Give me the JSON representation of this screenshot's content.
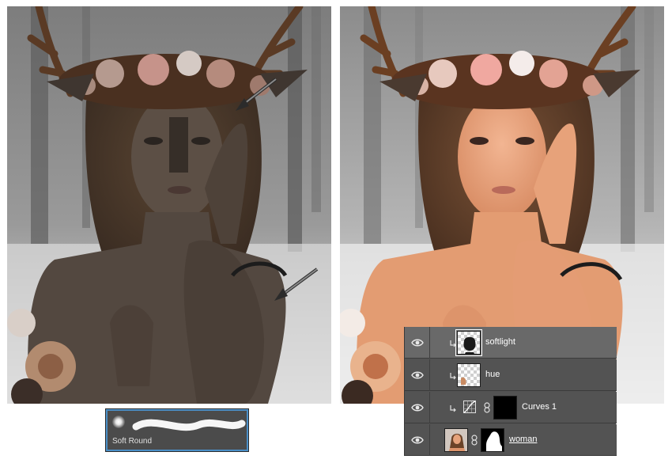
{
  "brush_preset": {
    "label": "Soft Round"
  },
  "layers_panel": {
    "rows": [
      {
        "name": "softlight",
        "selected": true,
        "clipped": true,
        "visible": true
      },
      {
        "name": "hue",
        "selected": false,
        "clipped": true,
        "visible": true
      },
      {
        "name": "Curves 1",
        "selected": false,
        "clipped": true,
        "visible": true,
        "adjustment": "curves"
      },
      {
        "name": "woman",
        "selected": false,
        "clipped": false,
        "visible": true,
        "has_mask": true
      }
    ]
  },
  "icons": [
    "eye-icon",
    "clipping-arrow-icon",
    "curves-icon",
    "mask-link-icon",
    "pointer-arrow-icon"
  ],
  "colors": {
    "panel_bg": "#535353",
    "selected_row": "#696969",
    "brush_border": "#4a8fc7"
  }
}
